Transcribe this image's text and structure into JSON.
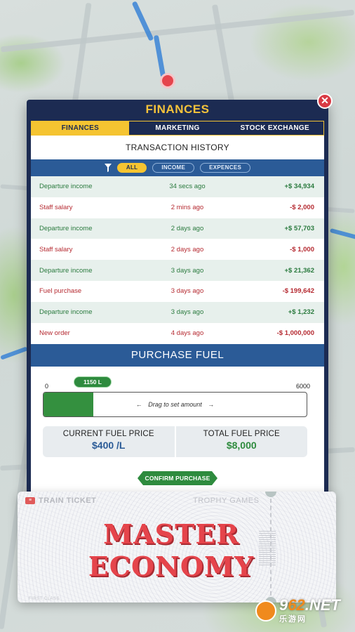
{
  "panel": {
    "title": "FINANCES",
    "close_glyph": "✕"
  },
  "tabs": [
    {
      "label": "FINANCES",
      "active": true
    },
    {
      "label": "MARKETING",
      "active": false
    },
    {
      "label": "STOCK EXCHANGE",
      "active": false
    }
  ],
  "history": {
    "title": "TRANSACTION HISTORY",
    "filters": [
      {
        "label": "ALL",
        "active": true
      },
      {
        "label": "INCOME",
        "active": false
      },
      {
        "label": "EXPENCES",
        "active": false
      }
    ],
    "rows": [
      {
        "desc": "Departure income",
        "time": "34 secs ago",
        "amount": "+$ 34,934",
        "type": "income"
      },
      {
        "desc": "Staff salary",
        "time": "2 mins ago",
        "amount": "-$ 2,000",
        "type": "expense"
      },
      {
        "desc": "Departure income",
        "time": "2 days ago",
        "amount": "+$ 57,703",
        "type": "income"
      },
      {
        "desc": "Staff salary",
        "time": "2 days ago",
        "amount": "-$ 1,000",
        "type": "expense"
      },
      {
        "desc": "Departure income",
        "time": "3 days ago",
        "amount": "+$ 21,362",
        "type": "income"
      },
      {
        "desc": "Fuel purchase",
        "time": "3 days ago",
        "amount": "-$ 199,642",
        "type": "expense"
      },
      {
        "desc": "Departure income",
        "time": "3 days ago",
        "amount": "+$ 1,232",
        "type": "income"
      },
      {
        "desc": "New order",
        "time": "4 days ago",
        "amount": "-$ 1,000,000",
        "type": "expense"
      }
    ]
  },
  "fuel": {
    "title": "PURCHASE FUEL",
    "min": "0",
    "max": "6000",
    "amount_label": "1150 L",
    "fill_fraction": 0.19,
    "hint": "Drag to set amount",
    "current_price_label": "CURRENT FUEL PRICE",
    "current_price": "$400 /L",
    "total_price_label": "TOTAL FUEL PRICE",
    "total_price": "$8,000",
    "confirm_label": "CONFIRM PURCHASE"
  },
  "ticket": {
    "label": "TRAIN TICKET",
    "brand": "TROPHY GAMES",
    "headline_1": "MASTER",
    "headline_2": "ECONOMY",
    "class_text": "FIRST CLASS"
  },
  "watermark": {
    "number_a": "9",
    "number_b": "62",
    "suffix": ".NET",
    "sub": "乐游网"
  },
  "colors": {
    "panel_bg": "#1c2b52",
    "accent_yellow": "#f5c431",
    "header_blue": "#2b5b97",
    "income_green": "#2a7a3e",
    "expense_red": "#b52a31",
    "headline_red": "#e5444b"
  }
}
